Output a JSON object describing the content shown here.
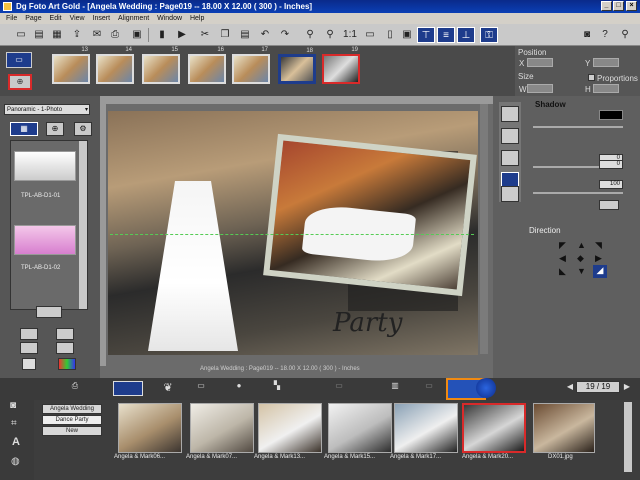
{
  "titlebar": {
    "title": "Dg Foto Art Gold - [Angela Wedding : Page019 -- 18.00 X 12.00 ( 300 ) - Inches]"
  },
  "menu": [
    "File",
    "Page",
    "Edit",
    "View",
    "Insert",
    "Alignment",
    "Window",
    "Help"
  ],
  "page_thumbs": [
    "13",
    "14",
    "15",
    "16",
    "17",
    "18",
    "19"
  ],
  "position_panel": {
    "position_label": "Position",
    "size_label": "Size",
    "x_label": "X",
    "y_label": "Y",
    "w_label": "W",
    "h_label": "H",
    "proportions_label": "Proportions"
  },
  "left_panel": {
    "dropdown": "Panoramic - 1-Photo",
    "template1": "TPL-AB-D1-01",
    "template2": "TPL-AB-D1-02"
  },
  "canvas": {
    "caption_text": "Party",
    "status": "Angela Wedding : Page019 -- 18.00 X 12.00 ( 300 ) - Inches"
  },
  "shadow_panel": {
    "title": "Shadow",
    "value1": "0",
    "value2": "0",
    "value3": "100",
    "direction_label": "Direction"
  },
  "bottom": {
    "albums": [
      "Angela Wedding",
      "Dance Party",
      "New"
    ],
    "page_counter": "19 / 19",
    "thumbs": [
      "Angela & Mark06...",
      "Angela & Mark07...",
      "Angela & Mark13...",
      "Angela & Mark15...",
      "Angela & Mark17...",
      "Angela & Mark20...",
      "DX01.jpg"
    ]
  }
}
